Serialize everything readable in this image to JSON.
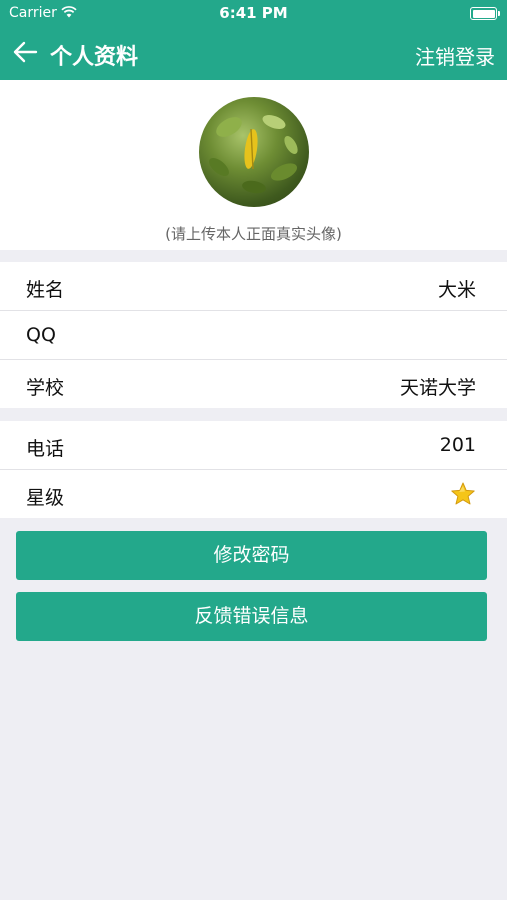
{
  "status_bar": {
    "carrier": "Carrier",
    "time": "6:41 PM"
  },
  "nav": {
    "title": "个人资料",
    "logout_label": "注销登录"
  },
  "avatar": {
    "hint": "(请上传本人正面真实头像)"
  },
  "profile": {
    "rows": [
      {
        "label": "姓名",
        "value": "大米"
      },
      {
        "label": "QQ",
        "value": ""
      },
      {
        "label": "学校",
        "value": "天诺大学"
      },
      {
        "label": "电话",
        "value": "201"
      },
      {
        "label": "星级",
        "value": ""
      }
    ],
    "star_rating": 1
  },
  "actions": {
    "change_password": "修改密码",
    "feedback": "反馈错误信息"
  },
  "colors": {
    "accent": "#23a88b",
    "background": "#eeeef3",
    "star": "#f5c518"
  },
  "icons": [
    "wifi-icon",
    "battery-icon",
    "back-arrow-icon",
    "star-icon"
  ]
}
